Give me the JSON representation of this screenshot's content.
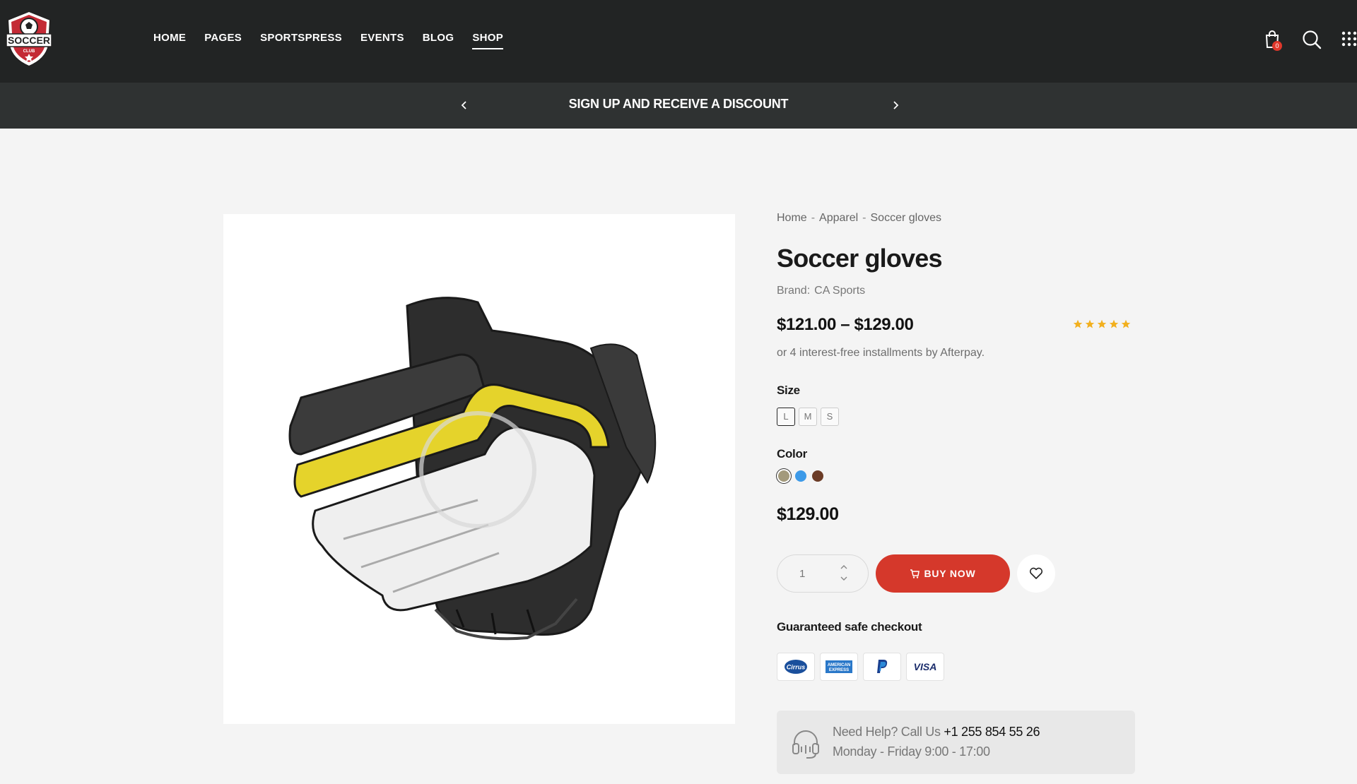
{
  "header": {
    "logo_alt": "SOCCER CLUB",
    "nav": [
      {
        "label": "HOME"
      },
      {
        "label": "PAGES"
      },
      {
        "label": "SPORTSPRESS"
      },
      {
        "label": "EVENTS"
      },
      {
        "label": "BLOG"
      },
      {
        "label": "SHOP",
        "active": true
      }
    ],
    "cart_count": "0",
    "icons": [
      "cart-icon",
      "search-icon",
      "grid-menu-icon"
    ]
  },
  "announcement": {
    "text": "SIGN UP AND RECEIVE A DISCOUNT",
    "icons": [
      "chevron-left-icon",
      "chevron-right-icon"
    ]
  },
  "product": {
    "image_alt": "Soccer gloves",
    "breadcrumb": [
      "Home",
      "Apparel",
      "Soccer gloves"
    ],
    "breadcrumb_sep": "-",
    "title": "Soccer gloves",
    "brand_label": "Brand:",
    "brand_value": "CA Sports",
    "price_range": "$121.00 – $129.00",
    "rating": 5,
    "rating_max": 5,
    "afterpay_text": "or 4 interest-free installments by Afterpay.",
    "size_label": "Size",
    "sizes": [
      "L",
      "M",
      "S"
    ],
    "selected_size": "L",
    "color_label": "Color",
    "colors": [
      "#a39a7c",
      "#3d9ae8",
      "#6b3b26"
    ],
    "selected_color_index": 0,
    "price": "$129.00",
    "quantity": "1",
    "buy_label": "BUY NOW",
    "checkout_label": "Guaranteed safe checkout",
    "payment_methods": [
      "Cirrus",
      "American Express",
      "PayPal",
      "VISA"
    ],
    "help_text": "Need Help? Call Us",
    "help_phone": "+1 255 854 55 26",
    "help_hours": "Monday - Friday 9:00 - 17:00"
  },
  "colors": {
    "header_bg": "#222424",
    "announce_bg": "#2f3232",
    "accent": "#d5382b",
    "star": "#f2b01e"
  }
}
